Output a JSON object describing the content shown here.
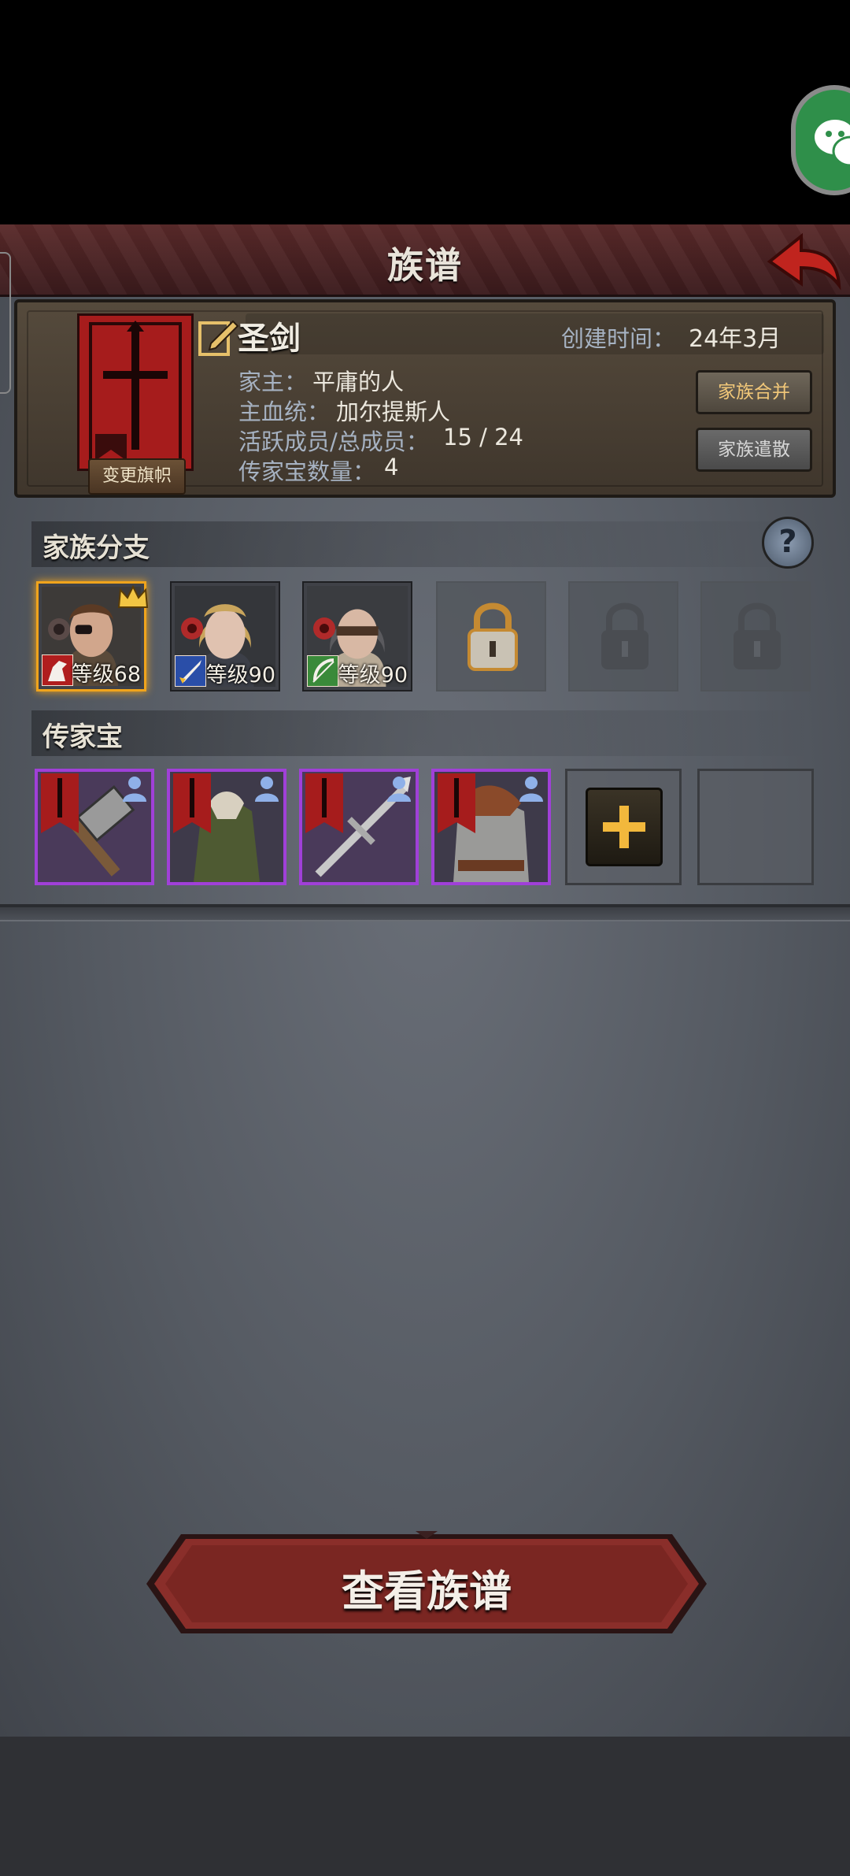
{
  "header": {
    "title": "族谱"
  },
  "family": {
    "name": "圣剑",
    "banner_button": "变更旗帜",
    "created_label": "创建时间：",
    "created_value": "24年3月",
    "head_label": "家主：",
    "head_value": "平庸的人",
    "bloodline_label": "主血统：",
    "bloodline_value": "加尔提斯人",
    "members_label": "活跃成员/总成员：",
    "members_value": "15 / 24",
    "heirloom_count_label": "传家宝数量：",
    "heirloom_count_value": "4",
    "merge_button": "家族合并",
    "disband_button": "家族遣散"
  },
  "branches": {
    "title": "家族分支",
    "help_label": "?",
    "members": [
      {
        "level": "等级68",
        "class_icon": "horse-icon",
        "head": true
      },
      {
        "level": "等级90",
        "class_icon": "sword-icon",
        "head": false
      },
      {
        "level": "等级90",
        "class_icon": "bow-icon",
        "head": false
      }
    ],
    "locked_slots": 3
  },
  "heirlooms": {
    "title": "传家宝",
    "items": [
      {
        "name": "hammer",
        "icon": "hammer-icon"
      },
      {
        "name": "green coat",
        "icon": "coat-icon"
      },
      {
        "name": "spear",
        "icon": "spear-icon"
      },
      {
        "name": "chainmail",
        "icon": "armor-icon"
      }
    ],
    "add_label": "+"
  },
  "bottom": {
    "view_button": "查看族谱"
  },
  "colors": {
    "accent_red": "#9a1818",
    "purple_frame": "#a040d8",
    "gold": "#f0a41c"
  }
}
